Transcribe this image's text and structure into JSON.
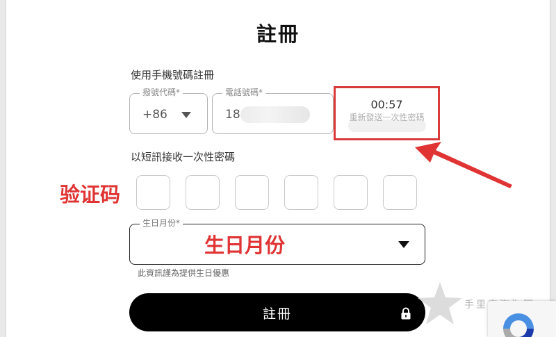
{
  "title": "註冊",
  "phone_section": {
    "label": "使用手機號碼註冊",
    "country_code": {
      "legend": "撥號代碼*",
      "value": "+86"
    },
    "phone_number": {
      "legend": "電話號碼*",
      "value": "18"
    },
    "resend": {
      "timer": "00:57",
      "label": "重新發送一次性密碼"
    }
  },
  "otp_section": {
    "label": "以短訊接收一次性密碼",
    "digits": [
      "",
      "",
      "",
      "",
      "",
      ""
    ]
  },
  "birth_month": {
    "legend": "生日月份*",
    "value": "",
    "helper": "此資訊謹為提供生日優惠"
  },
  "register_button": {
    "label": "註冊"
  },
  "annotations": {
    "otp": "验证码",
    "birth_month": "生日月份",
    "color": "#e03434"
  },
  "watermark": {
    "text": "手里来海淘网"
  },
  "colors": {
    "highlight_border": "#d93a3a",
    "button_bg": "#000000",
    "button_text": "#ffffff"
  },
  "icons": [
    "dropdown-caret-icon",
    "lock-icon",
    "recaptcha-icon",
    "arrow-icon",
    "star-icon"
  ]
}
